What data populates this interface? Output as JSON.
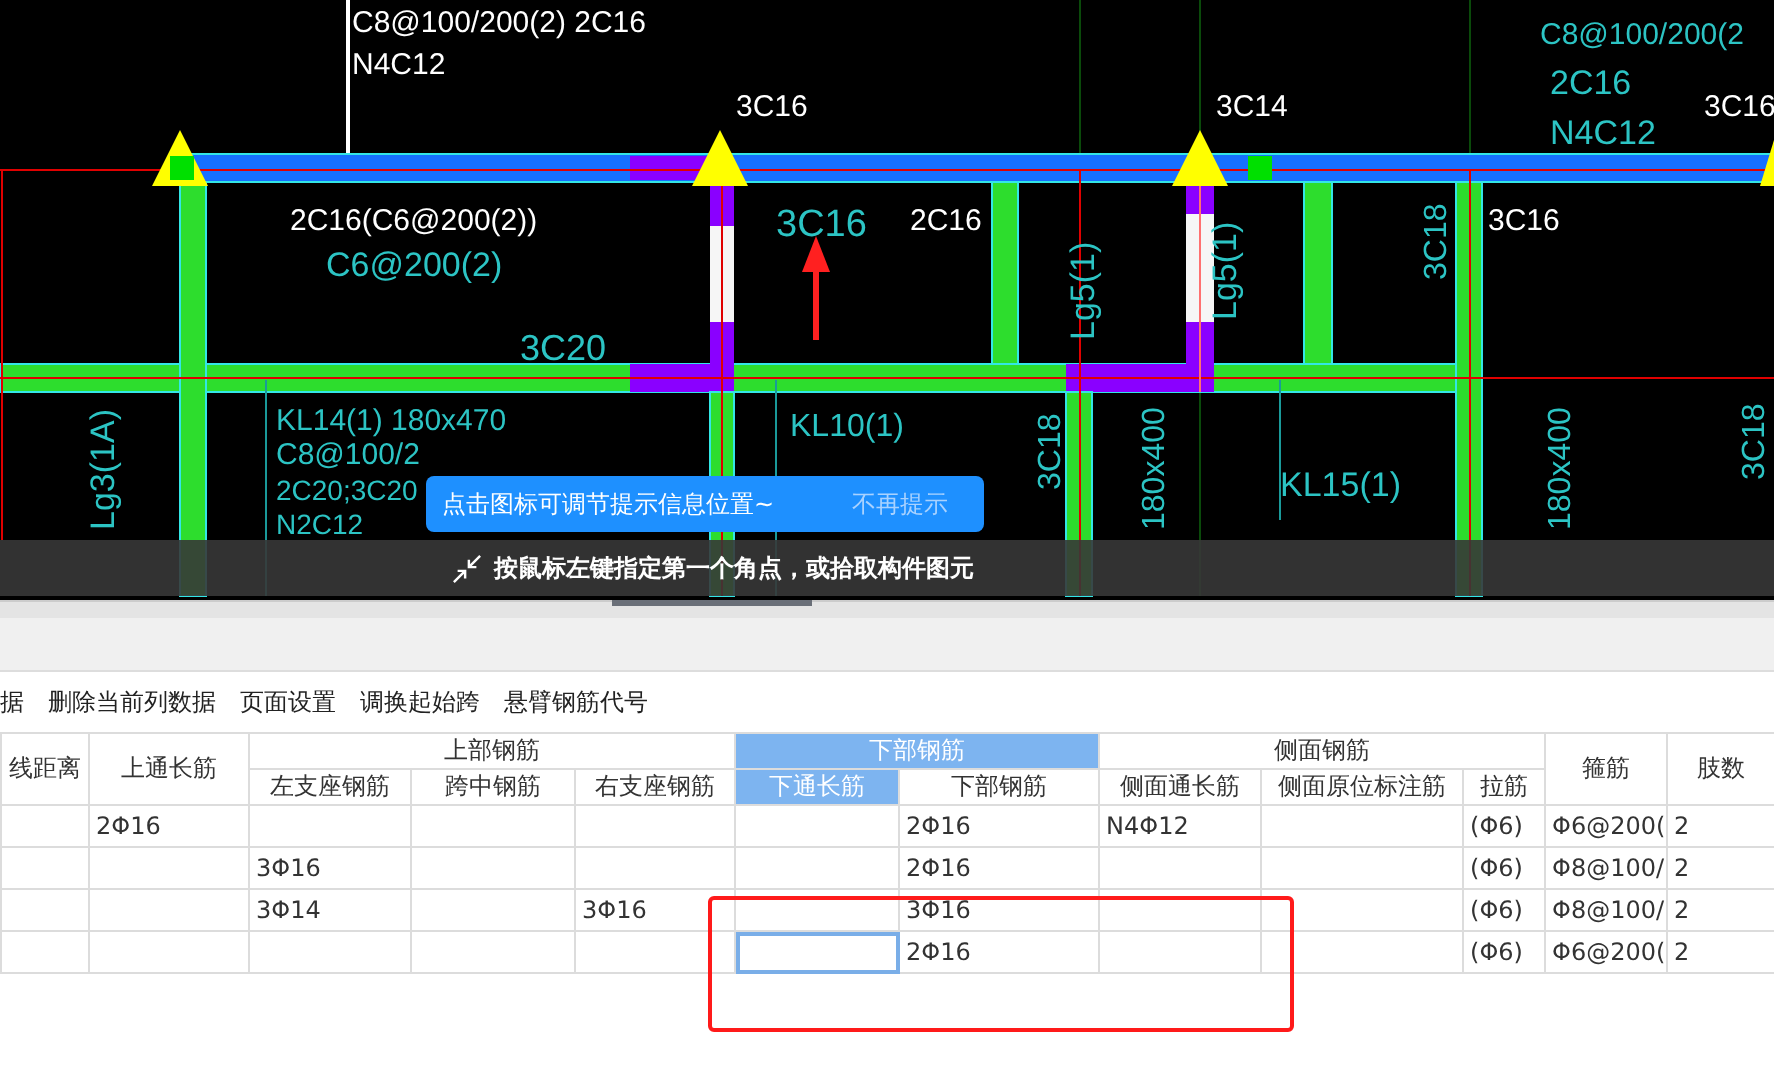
{
  "cad": {
    "labels": [
      {
        "text": "C8@100/200(2) 2C16",
        "kind": "callout"
      },
      {
        "text": "N4C12",
        "kind": "callout"
      },
      {
        "text": "3C16",
        "kind": "callout"
      },
      {
        "text": "3C14",
        "kind": "callout"
      },
      {
        "text": "3C16",
        "kind": "callout"
      },
      {
        "text": "2C16(C6@200(2))",
        "kind": "callout"
      },
      {
        "text": "2C16",
        "kind": "callout"
      },
      {
        "text": "3C16",
        "kind": "callout"
      },
      {
        "text": "C6@200(2)",
        "kind": "annotation"
      },
      {
        "text": "3C16",
        "kind": "annotation"
      },
      {
        "text": "3C20",
        "kind": "annotation"
      },
      {
        "text": "KL14(1) 180x470",
        "kind": "annotation"
      },
      {
        "text": "C8@100/2",
        "kind": "annotation"
      },
      {
        "text": "2C20;3C20",
        "kind": "annotation"
      },
      {
        "text": "N2C12",
        "kind": "annotation"
      },
      {
        "text": "KL10(1)",
        "kind": "annotation"
      },
      {
        "text": "KL15(1)",
        "kind": "annotation"
      },
      {
        "text": "Lg5(1)",
        "kind": "annotation"
      },
      {
        "text": "Lg5(1)",
        "kind": "annotation"
      },
      {
        "text": "3C18",
        "kind": "annotation"
      },
      {
        "text": "3C18",
        "kind": "annotation"
      },
      {
        "text": "180x400",
        "kind": "annotation"
      },
      {
        "text": "180x400",
        "kind": "annotation"
      },
      {
        "text": "Lg3(1A)",
        "kind": "annotation"
      },
      {
        "text": "C8@100/200(2",
        "kind": "annotation"
      },
      {
        "text": "2C16",
        "kind": "annotation"
      },
      {
        "text": "N4C12",
        "kind": "annotation"
      },
      {
        "text": "3C18",
        "kind": "annotation"
      }
    ],
    "tooltip": {
      "text": "点击图标可调节提示信息位置~",
      "dismiss": "不再提示"
    },
    "status_prompt": "按鼠标左键指定第一个角点，或拾取构件图元"
  },
  "toolbar": [
    "据",
    "删除当前列数据",
    "页面设置",
    "调换起始跨",
    "悬臂钢筋代号"
  ],
  "table": {
    "groups": [
      {
        "columns": [
          {
            "label": "线距离",
            "selected": false
          }
        ]
      },
      {
        "columns": [
          {
            "label": "上通长筋",
            "selected": false
          }
        ]
      },
      {
        "label": "上部钢筋",
        "selected": false,
        "columns": [
          {
            "label": "左支座钢筋",
            "selected": false
          },
          {
            "label": "跨中钢筋",
            "selected": false
          },
          {
            "label": "右支座钢筋",
            "selected": false
          }
        ]
      },
      {
        "label": "下部钢筋",
        "selected": true,
        "columns": [
          {
            "label": "下通长筋",
            "selected": true
          },
          {
            "label": "下部钢筋",
            "selected": false
          }
        ]
      },
      {
        "label": "侧面钢筋",
        "selected": false,
        "columns": [
          {
            "label": "侧面通长筋",
            "selected": false
          },
          {
            "label": "侧面原位标注筋",
            "selected": false
          },
          {
            "label": "拉筋",
            "selected": false
          }
        ]
      },
      {
        "columns": [
          {
            "label": "箍筋",
            "selected": false
          }
        ]
      },
      {
        "columns": [
          {
            "label": "肢数",
            "selected": false
          }
        ]
      }
    ],
    "rows": [
      {
        "cells": [
          {
            "selected": false
          },
          {
            "text": "2Φ16",
            "selected": false
          },
          {
            "selected": false
          },
          {
            "selected": false
          },
          {
            "selected": false
          },
          {
            "selected": false
          },
          {
            "text": "2Φ16",
            "selected": false
          },
          {
            "text": "N4Φ12",
            "selected": false
          },
          {
            "selected": false
          },
          {
            "text": "(Φ6)",
            "selected": false
          },
          {
            "text": "Φ6@200(",
            "selected": false
          },
          {
            "text": "2",
            "selected": false
          }
        ]
      },
      {
        "cells": [
          {
            "selected": false
          },
          {
            "selected": false
          },
          {
            "text": "3Φ16",
            "selected": false
          },
          {
            "selected": false
          },
          {
            "selected": false
          },
          {
            "selected": false
          },
          {
            "text": "2Φ16",
            "selected": false
          },
          {
            "selected": false
          },
          {
            "selected": false
          },
          {
            "text": "(Φ6)",
            "selected": false
          },
          {
            "text": "Φ8@100/",
            "selected": false
          },
          {
            "text": "2",
            "selected": false
          }
        ]
      },
      {
        "cells": [
          {
            "selected": false
          },
          {
            "selected": false
          },
          {
            "text": "3Φ14",
            "selected": false
          },
          {
            "selected": false
          },
          {
            "text": "3Φ16",
            "selected": false
          },
          {
            "selected": false
          },
          {
            "text": "3Φ16",
            "selected": false
          },
          {
            "selected": false
          },
          {
            "selected": false
          },
          {
            "text": "(Φ6)",
            "selected": false
          },
          {
            "text": "Φ8@100/",
            "selected": false
          },
          {
            "text": "2",
            "selected": false
          }
        ]
      },
      {
        "cells": [
          {
            "selected": false
          },
          {
            "selected": false
          },
          {
            "selected": false
          },
          {
            "selected": false
          },
          {
            "selected": false
          },
          {
            "selected": true
          },
          {
            "text": "2Φ16",
            "selected": false
          },
          {
            "selected": false
          },
          {
            "selected": false
          },
          {
            "text": "(Φ6)",
            "selected": false
          },
          {
            "text": "Φ6@200(",
            "selected": false
          },
          {
            "text": "2",
            "selected": false
          }
        ]
      }
    ]
  }
}
